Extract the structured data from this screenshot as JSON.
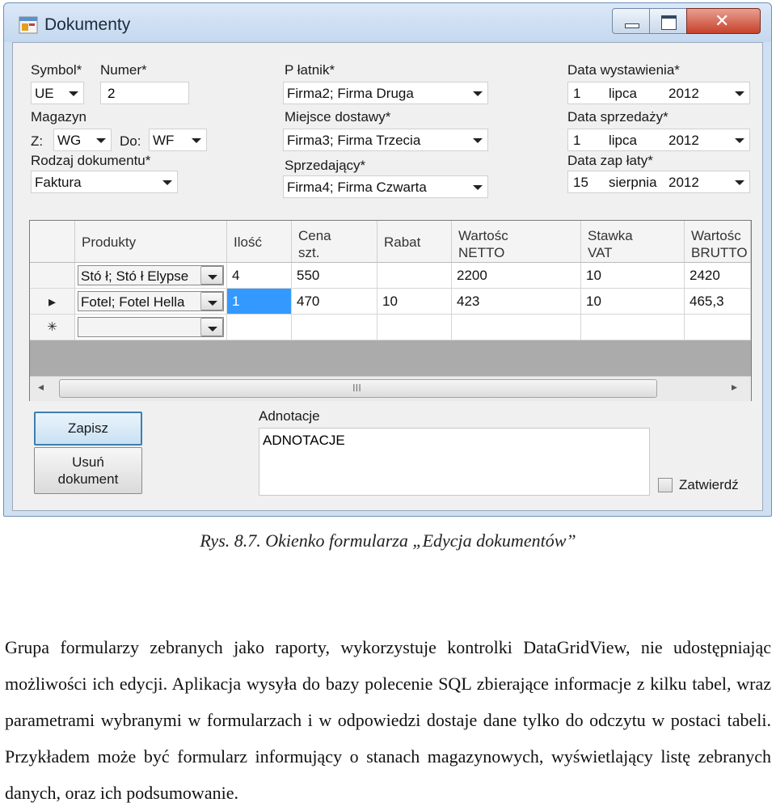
{
  "window": {
    "title": "Dokumenty",
    "close_glyph": "✕"
  },
  "form": {
    "symbol_label": "Symbol*",
    "symbol_value": "UE",
    "numer_label": "Numer*",
    "numer_value": "2",
    "magazyn_label": "Magazyn",
    "z_label": "Z:",
    "z_value": "WG",
    "do_label": "Do:",
    "do_value": "WF",
    "rodzaj_label": "Rodzaj dokumentu*",
    "rodzaj_value": "Faktura",
    "platnik_label": "P łatnik*",
    "platnik_value": "Firma2; Firma Druga",
    "miejsce_label": "Miejsce dostawy*",
    "miejsce_value": "Firma3; Firma Trzecia",
    "sprzedajacy_label": "Sprzedający*",
    "sprzedajacy_value": "Firma4; Firma Czwarta",
    "data_wyst_label": "Data wystawienia*",
    "data_wyst": {
      "day": "1",
      "month": "lipca",
      "year": "2012"
    },
    "data_sprz_label": "Data sprzedaży*",
    "data_sprz": {
      "day": "1",
      "month": "lipca",
      "year": "2012"
    },
    "data_zapl_label": "Data zap łaty*",
    "data_zapl": {
      "day": "15",
      "month": "sierpnia",
      "year": "2012"
    }
  },
  "grid": {
    "headers": [
      "Produkty",
      "Ilość",
      "Cena\nszt.",
      "Rabat",
      "Wartośc\nNETTO",
      "Stawka\nVAT",
      "Wartośc\nBRUTTO"
    ],
    "rows": [
      {
        "indicator": "",
        "produkt": "Stó ł; Stó ł Elypse",
        "ilosc": "4",
        "cena": "550",
        "rabat": "",
        "netto": "2200",
        "vat": "10",
        "brutto": "2420"
      },
      {
        "indicator": "▸",
        "produkt": "Fotel; Fotel Hella",
        "ilosc": "1",
        "cena": "470",
        "rabat": "10",
        "netto": "423",
        "vat": "10",
        "brutto": "465,3"
      }
    ],
    "new_row_indicator": "✳",
    "scroll_grip": "III",
    "scroll_left": "◂",
    "scroll_right": "▸"
  },
  "bottom": {
    "save_label": "Zapisz",
    "delete_label_1": "Usuń",
    "delete_label_2": "dokument",
    "adnotacje_label": "Adnotacje",
    "adnotacje_value": "ADNOTACJE",
    "zatwierdz_label": "Zatwierdź"
  },
  "document": {
    "caption": "Rys. 8.7. Okienko formularza „Edycja dokumentów”",
    "paragraph": "Grupa formularzy zebranych jako raporty, wykorzystuje kontrolki DataGridView, nie udostępniając możliwości ich edycji. Aplikacja wysyła do bazy polecenie SQL zbierające informacje z kilku tabel, wraz parametrami wybranymi w formularzach i w odpowiedzi dostaje dane tylko do odczytu w postaci tabeli. Przykładem może być formularz informujący o stanach magazynowych, wyświetlający listę zebranych danych, oraz ich podsumowanie."
  }
}
